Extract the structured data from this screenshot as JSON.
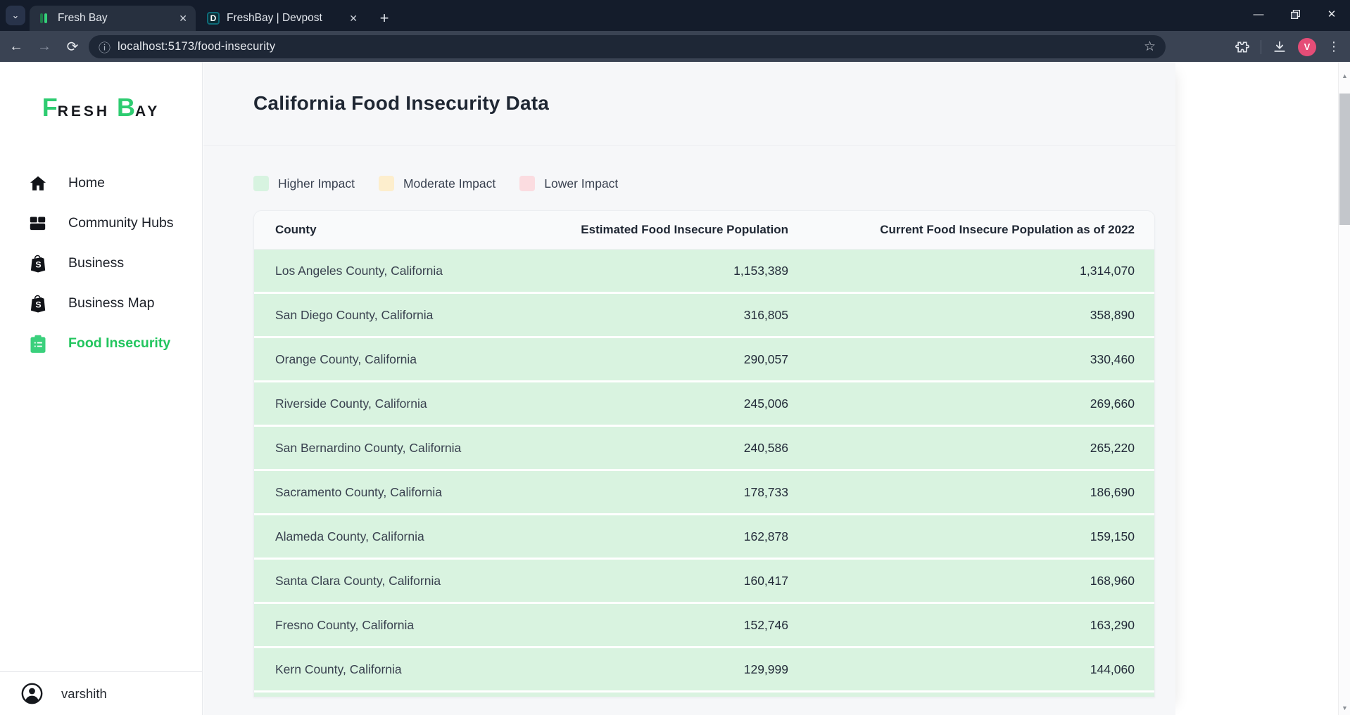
{
  "browser": {
    "tabs": [
      {
        "title": "Fresh Bay"
      },
      {
        "title": "FreshBay | Devpost",
        "favicon_letter": "D"
      }
    ],
    "url": "localhost:5173/food-insecurity",
    "profile_initial": "V",
    "close_glyph": "✕",
    "new_tab_glyph": "+",
    "back_glyph": "←",
    "forward_glyph": "→",
    "reload_glyph": "⟳",
    "info_glyph": "ⓘ",
    "star_glyph": "☆",
    "minimize_glyph": "—",
    "menu_glyph": "⋮",
    "chevron_glyph": "⌄"
  },
  "sidebar": {
    "logo": {
      "f": "F",
      "resh": "RESH",
      "b": "B",
      "ay": "AY"
    },
    "items": [
      {
        "label": "Home",
        "active": false
      },
      {
        "label": "Community Hubs",
        "active": false
      },
      {
        "label": "Business",
        "active": false
      },
      {
        "label": "Business Map",
        "active": false
      },
      {
        "label": "Food Insecurity",
        "active": true
      }
    ],
    "user": {
      "name": "varshith"
    }
  },
  "main": {
    "title": "California Food Insecurity Data",
    "legend": [
      {
        "label": "Higher Impact",
        "color": "#d7f3e0"
      },
      {
        "label": "Moderate Impact",
        "color": "#fdeecd"
      },
      {
        "label": "Lower Impact",
        "color": "#fbdce0"
      }
    ],
    "table": {
      "columns": [
        "County",
        "Estimated Food Insecure Population",
        "Current Food Insecure Population as of 2022"
      ],
      "rows": [
        {
          "county": "Los Angeles County, California",
          "estimated": "1,153,389",
          "current": "1,314,070"
        },
        {
          "county": "San Diego County, California",
          "estimated": "316,805",
          "current": "358,890"
        },
        {
          "county": "Orange County, California",
          "estimated": "290,057",
          "current": "330,460"
        },
        {
          "county": "Riverside County, California",
          "estimated": "245,006",
          "current": "269,660"
        },
        {
          "county": "San Bernardino County, California",
          "estimated": "240,586",
          "current": "265,220"
        },
        {
          "county": "Sacramento County, California",
          "estimated": "178,733",
          "current": "186,690"
        },
        {
          "county": "Alameda County, California",
          "estimated": "162,878",
          "current": "159,150"
        },
        {
          "county": "Santa Clara County, California",
          "estimated": "160,417",
          "current": "168,960"
        },
        {
          "county": "Fresno County, California",
          "estimated": "152,746",
          "current": "163,290"
        },
        {
          "county": "Kern County, California",
          "estimated": "129,999",
          "current": "144,060"
        }
      ],
      "row_highlight_color": "#d9f3e0"
    }
  }
}
